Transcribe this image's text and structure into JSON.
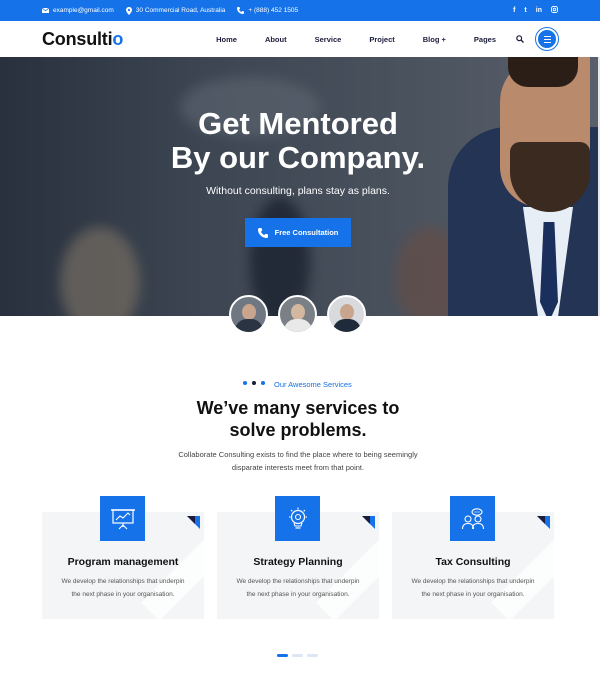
{
  "topbar": {
    "email": "example@gmail.com",
    "address": "30 Commercial Road, Australia",
    "phone": "+ (888) 452 1505",
    "social": [
      "f",
      "t",
      "in",
      "ig"
    ]
  },
  "header": {
    "logo_main": "Consulti",
    "logo_accent": "o",
    "nav": [
      "Home",
      "About",
      "Service",
      "Project",
      "Blog +",
      "Pages"
    ]
  },
  "hero": {
    "title_line1": "Get Mentored",
    "title_line2": "By our Company.",
    "subtitle": "Without consulting, plans stay as plans.",
    "cta": "Free Consultation"
  },
  "services": {
    "kicker": "Our Awesome Services",
    "title_line1": "We’ve many services to",
    "title_line2": "solve problems.",
    "desc_line1": "Collaborate Consulting exists to find the place where to being seemingly",
    "desc_line2": "disparate interests meet from that point.",
    "cards": [
      {
        "title": "Program management",
        "text1": "We develop the relationships that underpin",
        "text2": "the next phase in your organisation.",
        "icon": "presentation-chart-icon"
      },
      {
        "title": "Strategy Planning",
        "text1": "We develop the relationships that underpin",
        "text2": "the next phase in your organisation.",
        "icon": "lightbulb-gear-icon"
      },
      {
        "title": "Tax Consulting",
        "text1": "We develop the relationships that underpin",
        "text2": "the next phase in your organisation.",
        "icon": "people-chat-icon"
      }
    ]
  },
  "colors": {
    "accent": "#1572e8",
    "dark": "#1c1c3c"
  }
}
